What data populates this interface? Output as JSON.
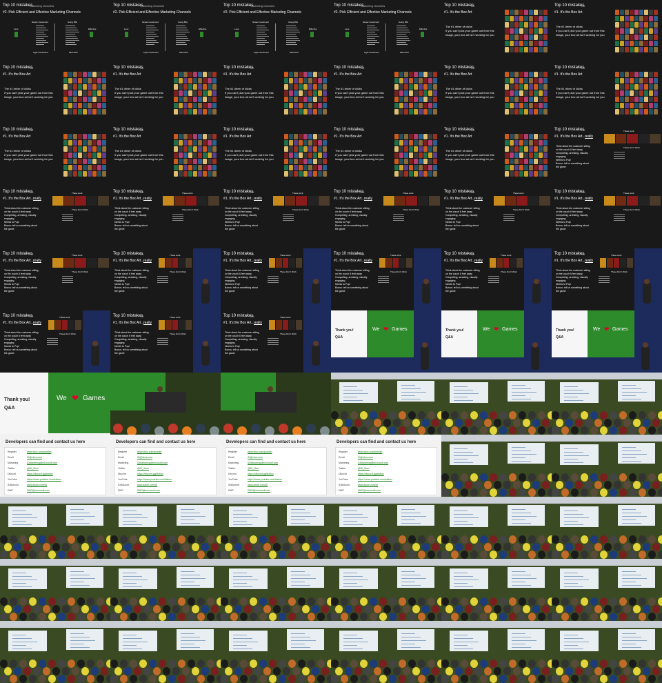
{
  "slides": {
    "channels": {
      "title": "Top 10 mistakes",
      "section": "~ Marketing channels",
      "subtitle": "#2. Pick Efficient and Effective Marketing Channels",
      "col1": "Newer investment",
      "col2": "Going BIG",
      "left": "Less",
      "right": "Effective",
      "foot1": "Light investment",
      "foot2": "Most ROI"
    },
    "boxart": {
      "title": "Top 10 mistakes",
      "section": "~ Art",
      "subtitle": "#1. It's the Box Art",
      "bullets": [
        "The #1 driver of clicks",
        "If you can't pick your game out from this",
        "image, your box art isn't working for you"
      ]
    },
    "boxart_really": {
      "title": "Top 10 mistakes",
      "section": "~ Art",
      "subtitle": "#1. It's the Box Art...",
      "really": "really",
      "these_work": "These work",
      "these_dont": "These Don't Work",
      "bullets": [
        "Think about the customer sitting",
        "on the couch 6 feet away",
        "Compelling, arresting, visually",
        "engaging",
        "Needs to Pop!",
        "Bonus: tell us something about",
        "the game"
      ]
    },
    "thanks": {
      "title": "Thank you!",
      "qa": "Q&A",
      "we": "We",
      "games": "Games",
      "heart": "❤"
    },
    "contact": {
      "title": "Developers can find and contact us here",
      "rows": [
        {
          "label": "Register",
          "value": "www.xbox.com/publish"
        },
        {
          "label": "Email",
          "value": "ID@xbox.com"
        },
        {
          "label": "Marketing",
          "value": "IDMarketing@microsoft.com"
        },
        {
          "label": "Twitter",
          "value": "@ID_Xbox"
        },
        {
          "label": "Discord",
          "value": "https://discord.gg/idxbox"
        },
        {
          "label": "YouTube",
          "value": "https://www.youtube.com/idxbox"
        },
        {
          "label": "ID@Azure",
          "value": "www.azure.com/ID"
        },
        {
          "label": "DMP",
          "value": "DMP@microsoft.com"
        }
      ]
    }
  },
  "frames": [
    "channels",
    "channels",
    "channels",
    "channels",
    "boxart",
    "boxart",
    "boxart",
    "boxart",
    "boxart",
    "boxart",
    "boxart",
    "boxart",
    "boxart",
    "boxart",
    "boxart",
    "boxart",
    "boxart",
    "really",
    "really",
    "really",
    "really",
    "really",
    "really",
    "really",
    "really",
    "really_cam",
    "really_cam",
    "really_cam",
    "really_cam",
    "really_cam",
    "really_cam",
    "really_cam",
    "really_cam",
    "thanks_cam",
    "thanks_cam",
    "thanks_cam",
    "thanks_full",
    "room_slide",
    "room_slide",
    "room_wide",
    "room_wide",
    "room_wide",
    "contact",
    "contact",
    "contact",
    "contact",
    "room_wide",
    "room_wide",
    "room_wide",
    "room_wide",
    "room_wide",
    "room_wide",
    "room_wide",
    "room_wide",
    "room_wide",
    "room_wide",
    "room_wide",
    "room_wide",
    "room_wide",
    "room_wide",
    "room_wide",
    "room_wide",
    "room_wide",
    "room_wide",
    "room_wide",
    "room_wide"
  ],
  "colors": {
    "slide_bg": "#191919",
    "xbox_green": "#2e8b2b",
    "link_green": "#107c10",
    "stage_blue": "#1d2b5c",
    "room_wall": "#3a4a22"
  }
}
